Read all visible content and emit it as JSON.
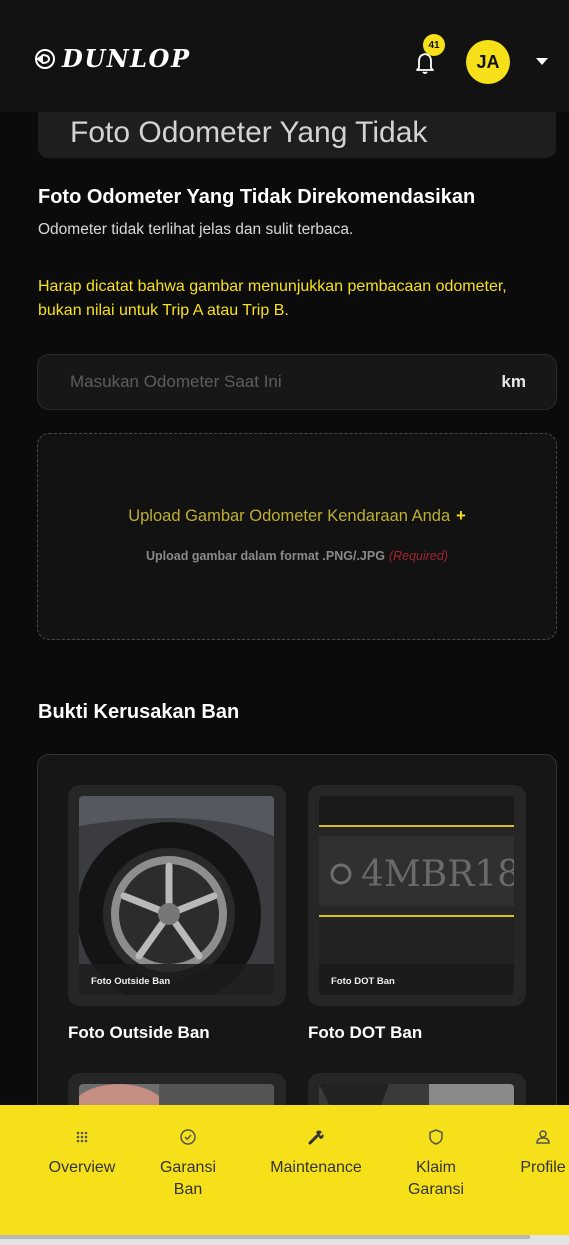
{
  "header": {
    "brand": "DUNLOP",
    "notification_count": "41",
    "avatar_initials": "JA"
  },
  "example_card": {
    "title": "Foto Odometer Yang Tidak"
  },
  "not_recommended": {
    "title": "Foto Odometer Yang Tidak Direkomendasikan",
    "description": "Odometer tidak terlihat jelas dan sulit terbaca."
  },
  "notice": "Harap dicatat bahwa gambar menunjukkan pembacaan odometer, bukan nilai untuk Trip A atau Trip B.",
  "odometer": {
    "placeholder": "Masukan Odometer Saat Ini",
    "unit": "km",
    "value": ""
  },
  "upload": {
    "title": "Upload Gambar Odometer Kendaraan Anda",
    "plus": "+",
    "hint": "Upload gambar dalam format .PNG/.JPG",
    "required": "(Required)"
  },
  "damage_section": {
    "title": "Bukti Kerusakan Ban",
    "photos": [
      {
        "caption": "Foto Outside Ban",
        "label": "Foto Outside Ban"
      },
      {
        "caption": "Foto DOT Ban",
        "label": "Foto DOT Ban"
      }
    ],
    "dot_text": "4MBR18"
  },
  "bottom_nav": [
    {
      "label": "Overview",
      "icon": "grid-icon"
    },
    {
      "label": "Garansi Ban",
      "icon": "check-badge-icon"
    },
    {
      "label": "Maintenance",
      "icon": "wrench-icon"
    },
    {
      "label": "Klaim Garansi",
      "icon": "shield-icon"
    },
    {
      "label": "Profile",
      "icon": "user-icon"
    }
  ],
  "colors": {
    "accent": "#f5e019",
    "background": "#0b0b0b",
    "required": "#a0262b"
  }
}
